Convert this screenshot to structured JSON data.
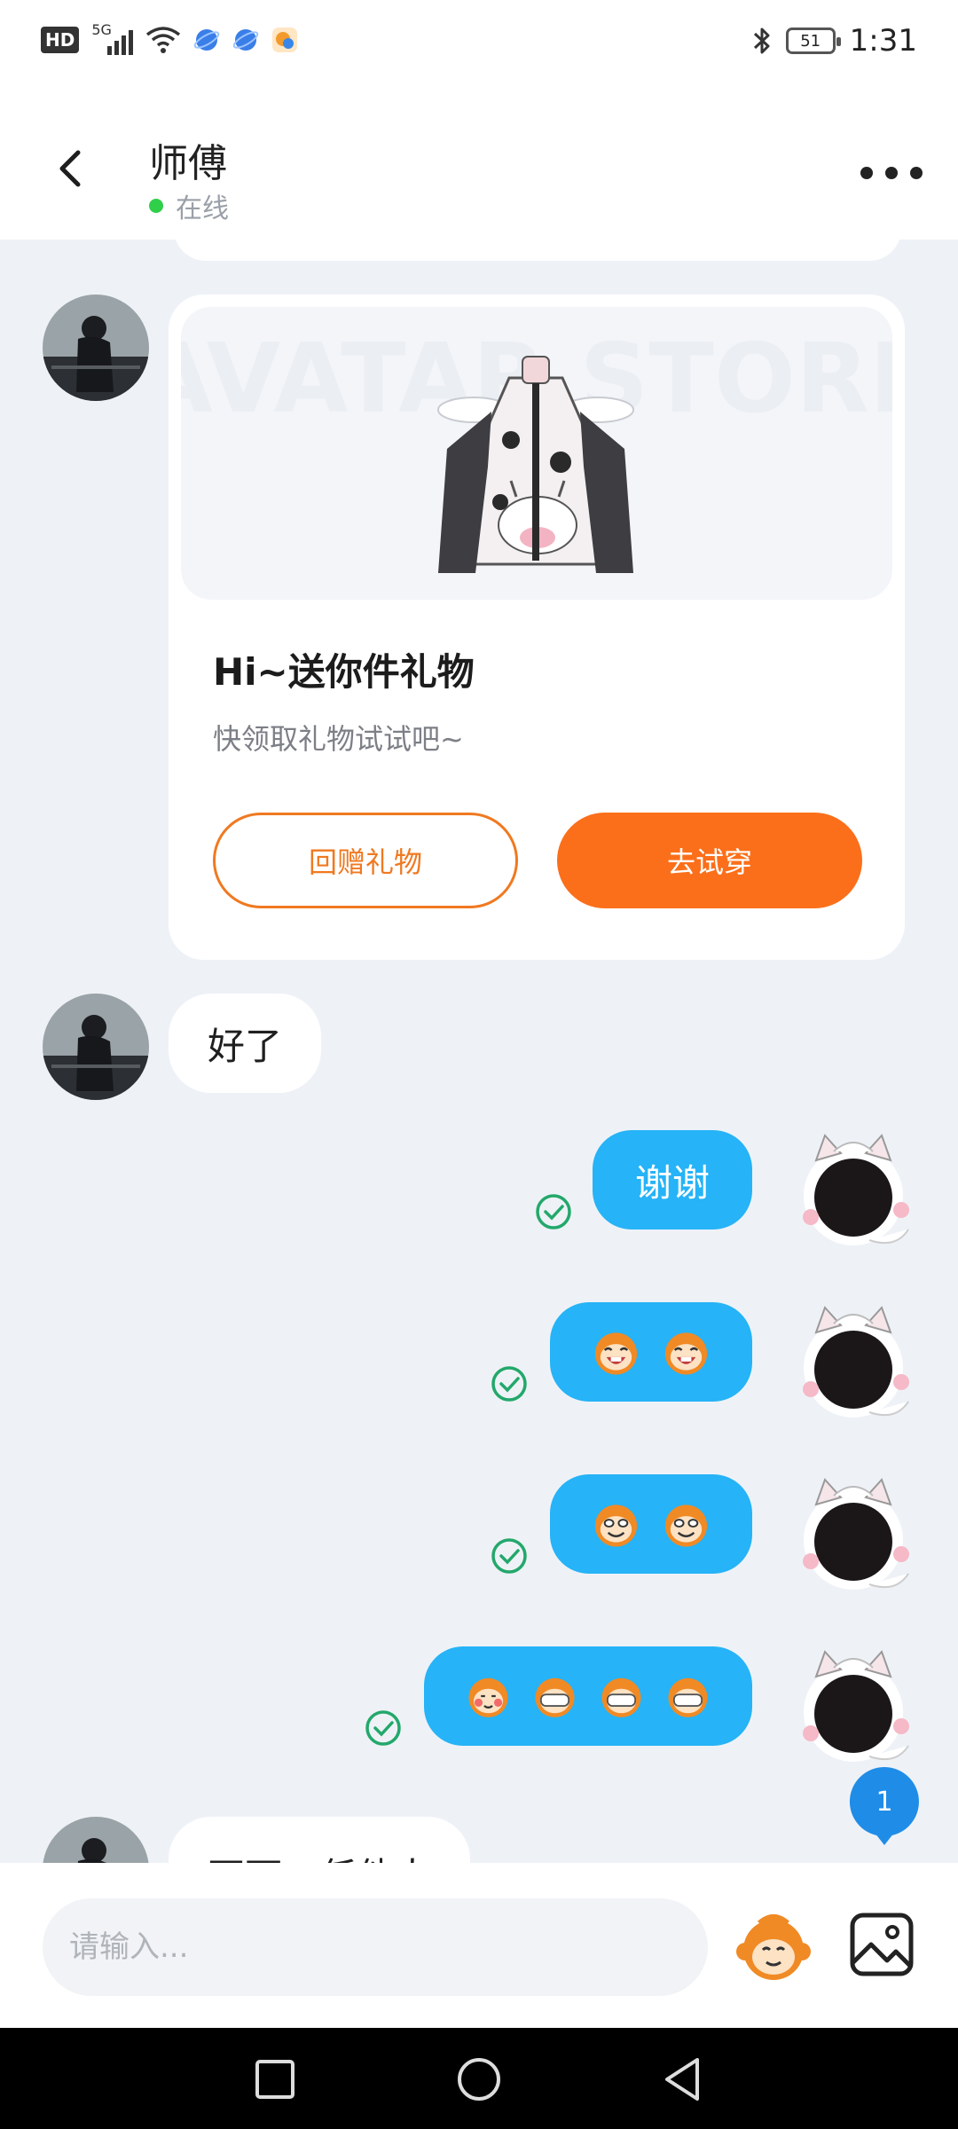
{
  "status_bar": {
    "hd": "HD",
    "network": "5G",
    "battery": "51",
    "time": "1:31"
  },
  "header": {
    "title": "师傅",
    "status": "在线"
  },
  "gift_card": {
    "watermark": "AVATAR STORE",
    "title": "Hi~送你件礼物",
    "subtitle": "快领取礼物试试吧~",
    "return_gift_label": "回赠礼物",
    "try_on_label": "去试穿"
  },
  "messages": [
    {
      "side": "in",
      "text": "好了"
    },
    {
      "side": "out",
      "text": "谢谢"
    },
    {
      "side": "out",
      "emojis": [
        "laughing-monkey",
        "laughing-monkey"
      ]
    },
    {
      "side": "out",
      "emojis": [
        "grinning-monkey",
        "grinning-monkey"
      ]
    },
    {
      "side": "out",
      "emojis": [
        "blushing-monkey",
        "hiding-monkey",
        "hiding-monkey",
        "hiding-monkey"
      ]
    },
    {
      "side": "in",
      "text": "不可二任他人"
    }
  ],
  "new_message_badge": "1",
  "input": {
    "placeholder": "请输入..."
  },
  "colors": {
    "accent_orange": "#fb6f1a",
    "bubble_blue": "#26b3f7",
    "online_green": "#2fcf4a"
  }
}
